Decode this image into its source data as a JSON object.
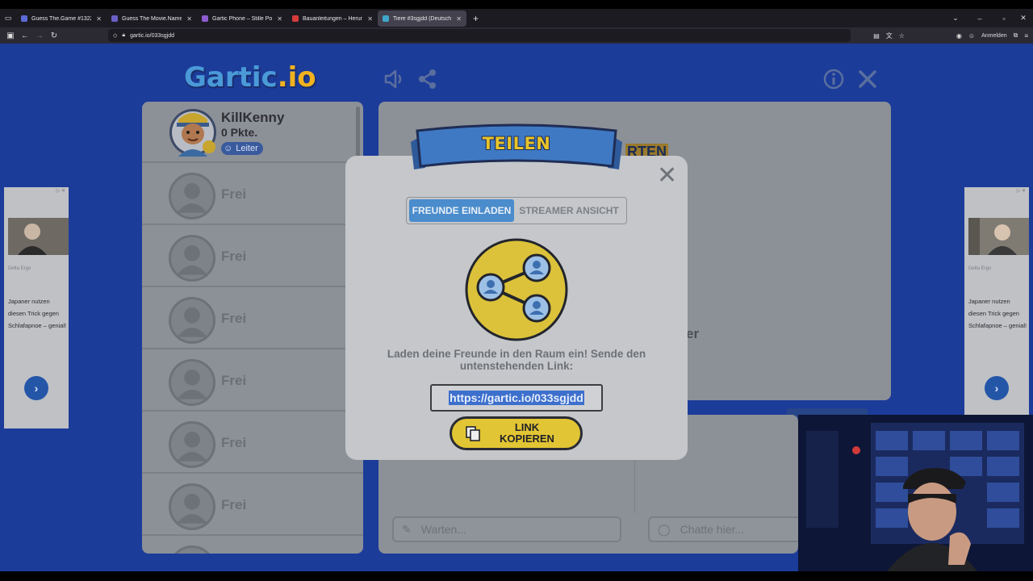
{
  "browser": {
    "tabs": [
      {
        "title": "Guess The.Game #1322",
        "fav": "#5b6bd6"
      },
      {
        "title": "Guess The Movie.Name #457",
        "fav": "#6a5fc7"
      },
      {
        "title": "Gartic Phone – Stille Post",
        "fav": "#8d5bd0"
      },
      {
        "title": "Bauanleitungen – Herunterlade",
        "fav": "#d63b3b"
      },
      {
        "title": "Tiere #3sgjdd (Deutsch) - Gartic",
        "fav": "#3fa6c9"
      }
    ],
    "url": "gartic.io/033sgjdd",
    "signin": "Anmelden"
  },
  "game": {
    "logo_main": "Gartic",
    "logo_io": ".io",
    "me": {
      "name": "KillKenny",
      "points": "0 Pkte.",
      "badge": "Leiter"
    },
    "free_label": "Frei",
    "draw_placeholder": "Warten...",
    "chat_placeholder": "Chatte hier...",
    "behind_text": "er",
    "behind_badge": "RTEN"
  },
  "modal": {
    "title": "TEILEN",
    "tab_invite": "FREUNDE EINLADEN",
    "tab_streamer": "STREAMER ANSICHT",
    "message": "Laden deine Freunde in den Raum ein! Sende den untenstehenden Link:",
    "link": "https://gartic.io/033sgjdd",
    "copy_line1": "LINK",
    "copy_line2": "KOPIEREN",
    "close": "✕"
  },
  "ads": {
    "source": "Delta Ergo",
    "text": "Japaner nutzen diesen Trick gegen Schlafapnoe – genial!",
    "arrow": "›"
  },
  "colors": {
    "page_bg": "#1c3c9a",
    "accent_blue": "#4a8ccc",
    "button_yellow": "#e2c534"
  }
}
